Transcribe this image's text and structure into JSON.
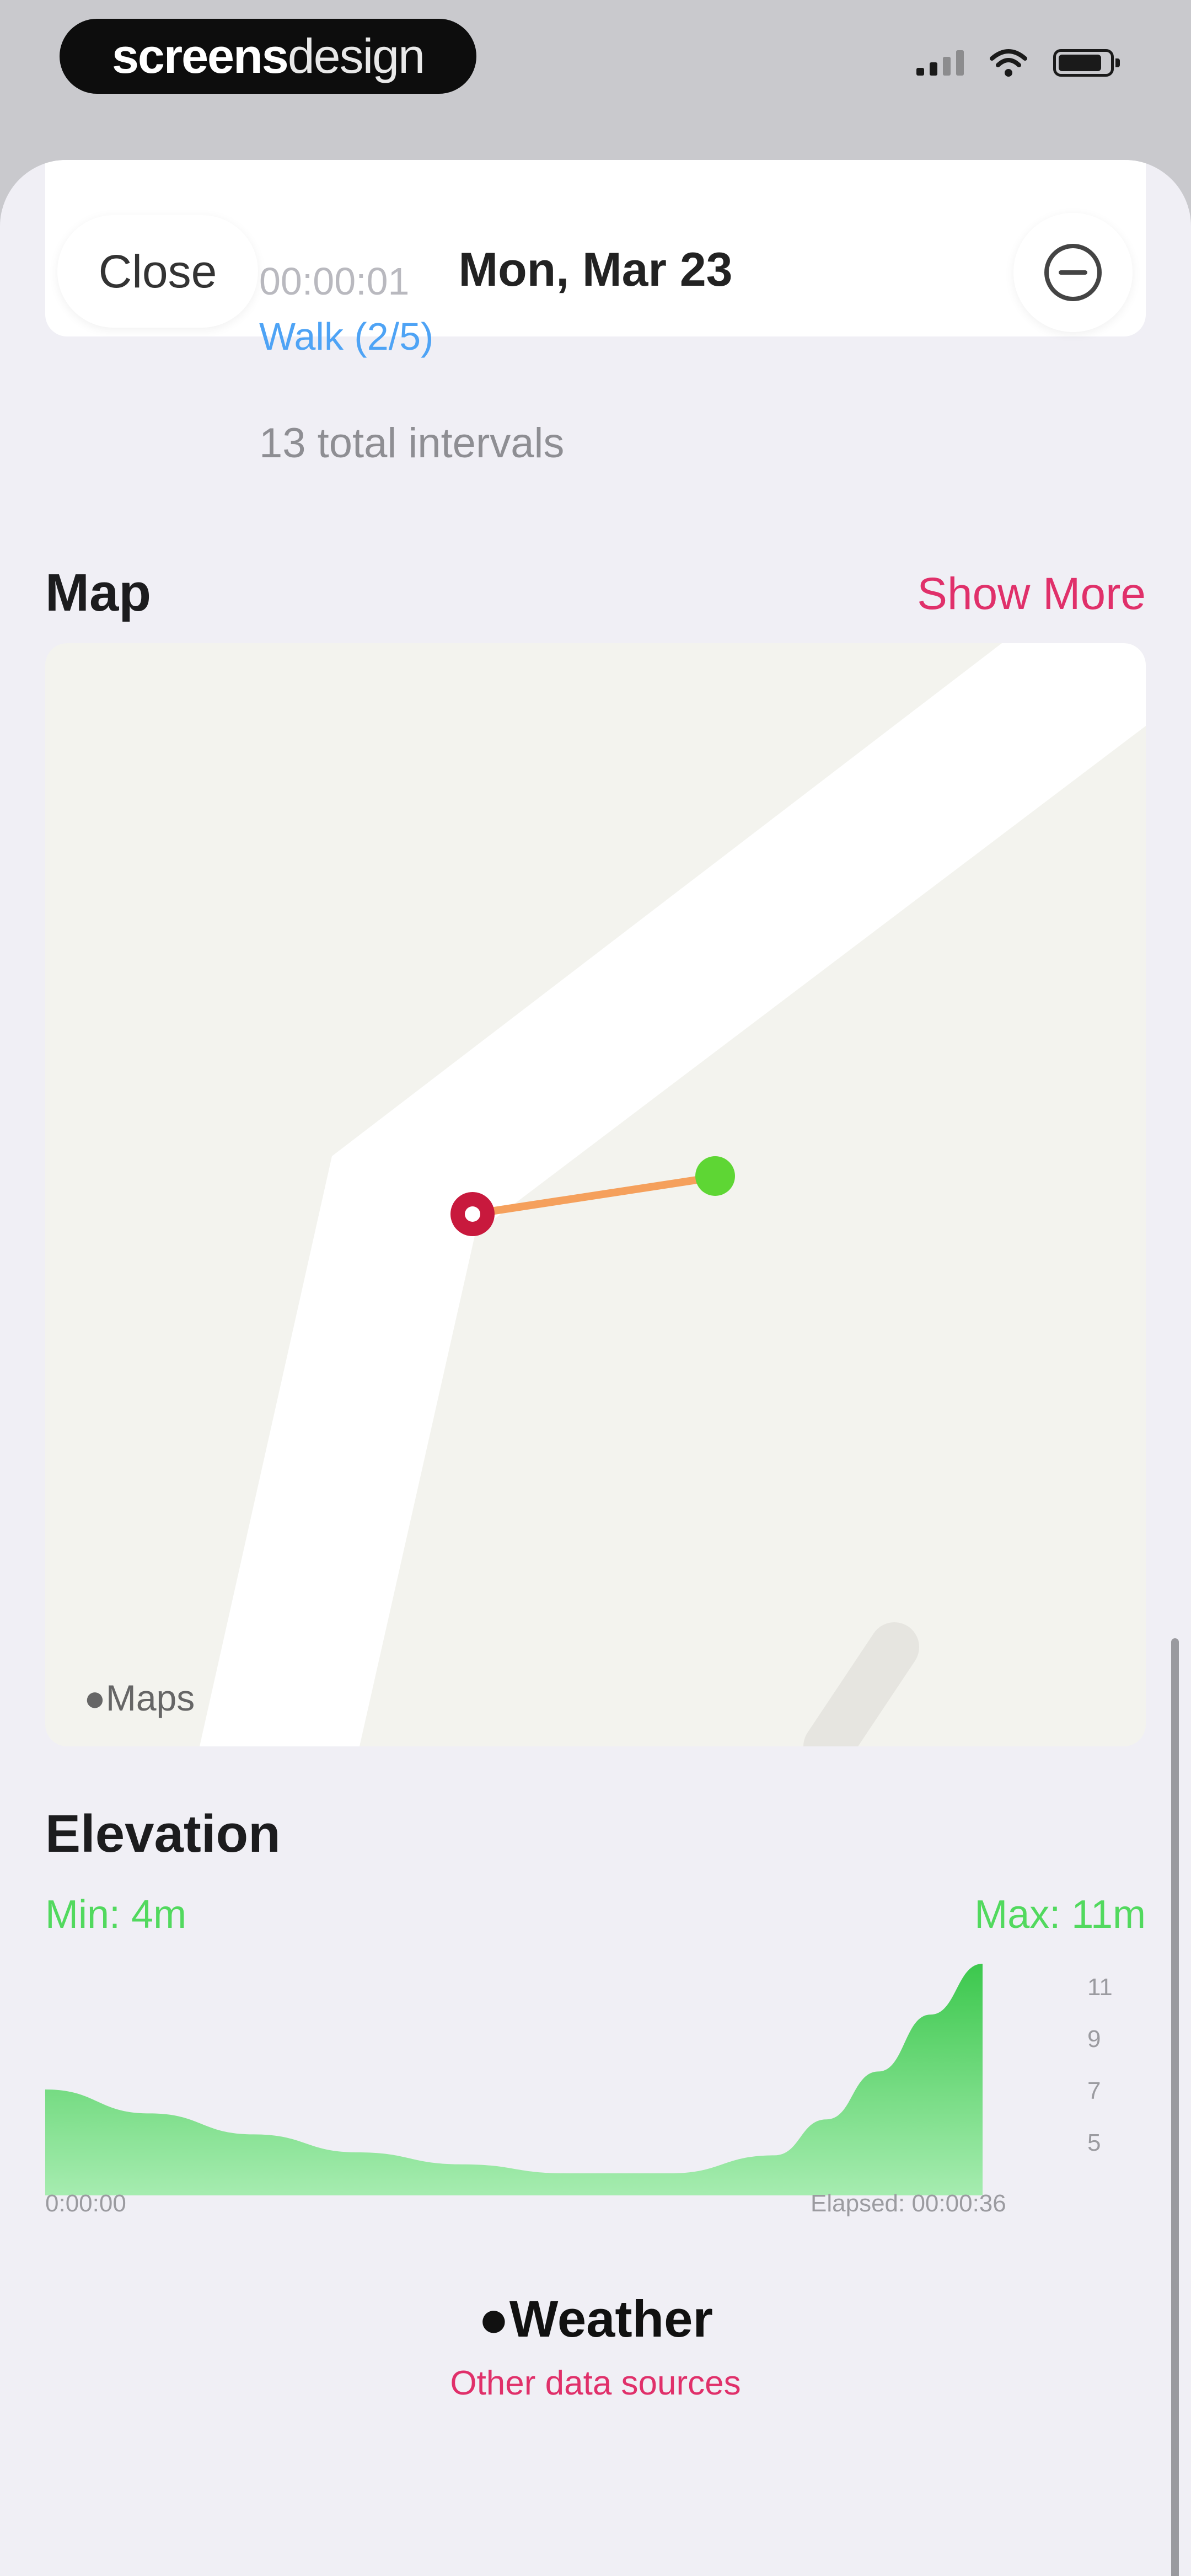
{
  "status_bar": {
    "brand_bold": "screens",
    "brand_light": "design"
  },
  "sheet": {
    "close_label": "Close",
    "title": "Mon, Mar 23"
  },
  "intervals": {
    "timecode": "00:00:01",
    "current": "Walk (2/5)",
    "total": "13 total intervals"
  },
  "map": {
    "title": "Map",
    "show_more": "Show More",
    "attribution": "Maps"
  },
  "elevation": {
    "title": "Elevation",
    "min": "Min: 4m",
    "max": "Max: 11m"
  },
  "chart_data": {
    "type": "area",
    "x": [
      0,
      4,
      8,
      12,
      16,
      20,
      24,
      28,
      30,
      32,
      34,
      36
    ],
    "y": [
      6.8,
      6.0,
      5.3,
      4.7,
      4.3,
      4.0,
      4.0,
      4.6,
      5.8,
      7.4,
      9.3,
      11.0
    ],
    "y_ticks": [
      "11",
      "9",
      "7",
      "5"
    ],
    "x_ticks": [
      "0:00:00",
      "Elapsed: 00:00:36"
    ],
    "ylim": [
      4,
      11
    ],
    "color": "#3cc84d"
  },
  "footer": {
    "weather": "Weather",
    "sources": "Other data sources"
  },
  "colors": {
    "accent": "#e0306a",
    "elevation": "#52d95e",
    "route": "#f5a05c"
  }
}
